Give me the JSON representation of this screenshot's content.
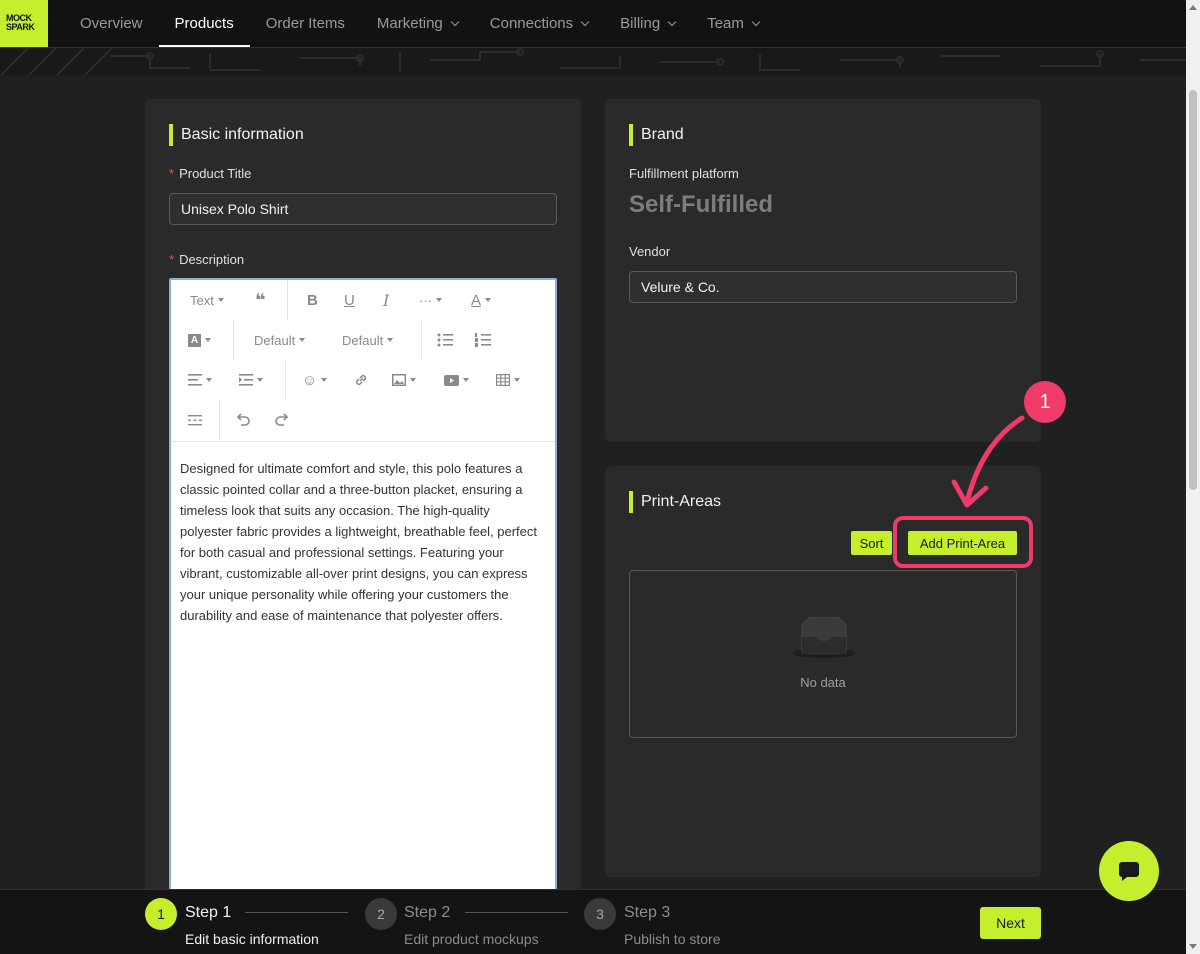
{
  "brand": {
    "logo_line1": "MOCK",
    "logo_line2": "SPARK"
  },
  "nav": [
    {
      "label": "Overview",
      "dropdown": false,
      "active": false
    },
    {
      "label": "Products",
      "dropdown": false,
      "active": true
    },
    {
      "label": "Order Items",
      "dropdown": false,
      "active": false
    },
    {
      "label": "Marketing",
      "dropdown": true,
      "active": false
    },
    {
      "label": "Connections",
      "dropdown": true,
      "active": false
    },
    {
      "label": "Billing",
      "dropdown": true,
      "active": false
    },
    {
      "label": "Team",
      "dropdown": true,
      "active": false
    }
  ],
  "basic": {
    "title": "Basic information",
    "product_title_label": "Product Title",
    "product_title_value": "Unisex Polo Shirt",
    "description_label": "Description",
    "required_mark": "*",
    "toolbar": {
      "text_style": "Text",
      "font_size": "Default",
      "font_family": "Default"
    },
    "description_text": "Designed for ultimate comfort and style, this polo features a classic pointed collar and a three-button placket, ensuring a timeless look that suits any occasion. The high-quality polyester fabric provides a lightweight, breathable feel, perfect for both casual and professional settings. Featuring your vibrant, customizable all-over print designs, you can express your unique personality while offering your customers the durability and ease of maintenance that polyester offers."
  },
  "brand_card": {
    "title": "Brand",
    "fulfillment_label": "Fulfillment platform",
    "fulfillment_value": "Self-Fulfilled",
    "vendor_label": "Vendor",
    "vendor_value": "Velure & Co."
  },
  "print_areas": {
    "title": "Print-Areas",
    "sort_label": "Sort",
    "add_label": "Add Print-Area",
    "empty_text": "No data"
  },
  "annotation": {
    "badge": "1",
    "color": "#f03a6a"
  },
  "steps": [
    {
      "num": "1",
      "title": "Step 1",
      "desc": "Edit basic information",
      "active": true
    },
    {
      "num": "2",
      "title": "Step 2",
      "desc": "Edit product mockups",
      "active": false
    },
    {
      "num": "3",
      "title": "Step 3",
      "desc": "Publish to store",
      "active": false
    }
  ],
  "next_label": "Next",
  "colors": {
    "accent": "#c5ef2c",
    "highlight": "#f03a6a"
  }
}
